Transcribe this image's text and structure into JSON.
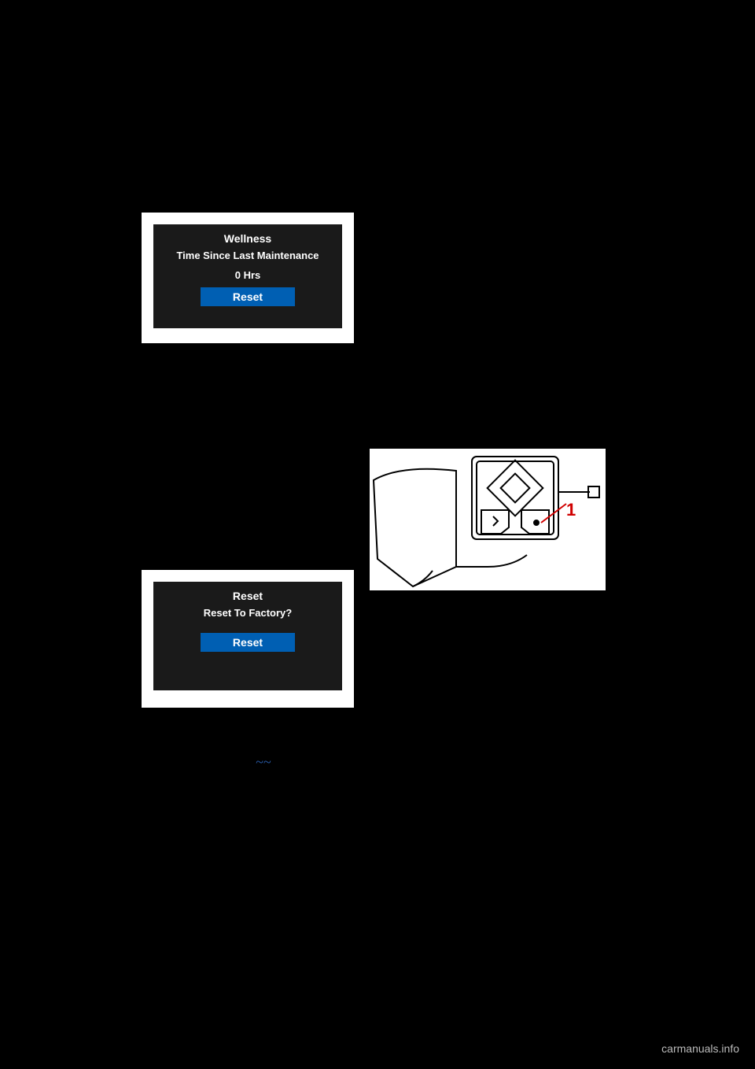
{
  "screen1": {
    "title": "Wellness",
    "subtitle": "Time Since Last Maintenance",
    "value": "0   Hrs",
    "button": "Reset"
  },
  "screen2": {
    "title": "Reset",
    "subtitle": "Reset To Factory?",
    "button": "Reset"
  },
  "diagram": {
    "callout_1": "1"
  },
  "separator": "~~",
  "watermark": "carmanuals.info"
}
